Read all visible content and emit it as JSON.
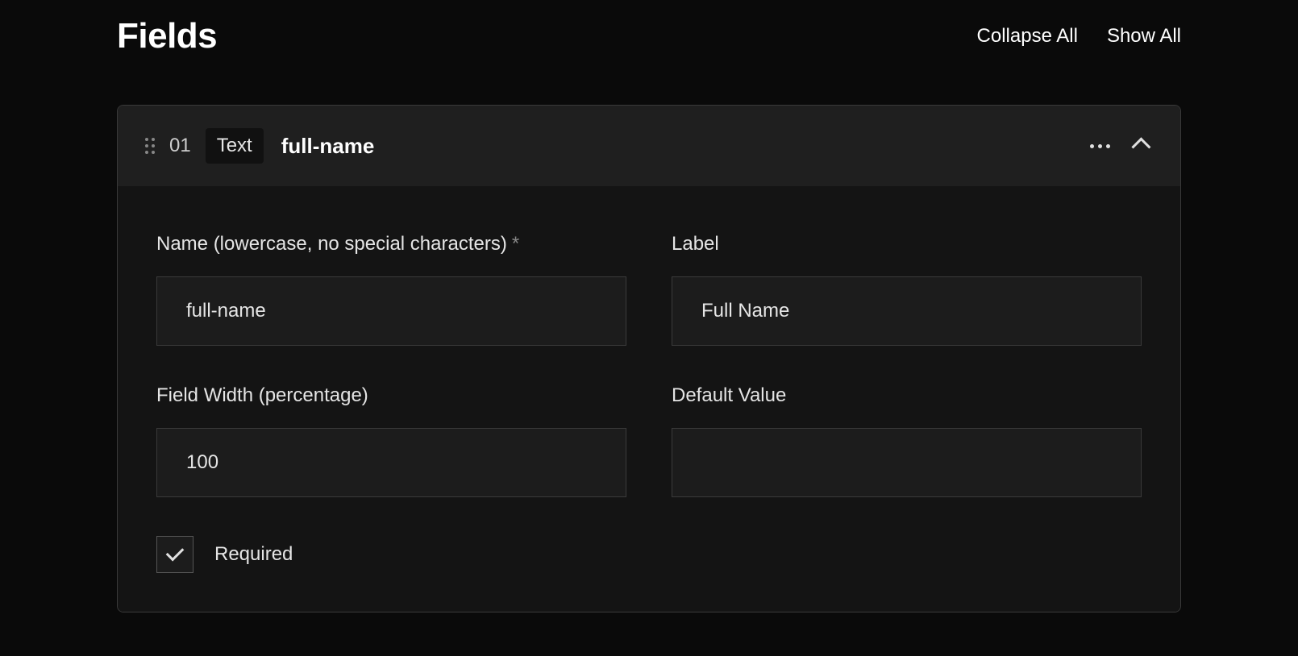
{
  "header": {
    "title": "Fields",
    "collapse_all": "Collapse All",
    "show_all": "Show All"
  },
  "field": {
    "number": "01",
    "type": "Text",
    "name": "full-name",
    "form": {
      "name_label": "Name (lowercase, no special characters)",
      "name_value": "full-name",
      "label_label": "Label",
      "label_value": "Full Name",
      "width_label": "Field Width (percentage)",
      "width_value": "100",
      "default_label": "Default Value",
      "default_value": "",
      "required_label": "Required",
      "required_checked": true
    }
  }
}
